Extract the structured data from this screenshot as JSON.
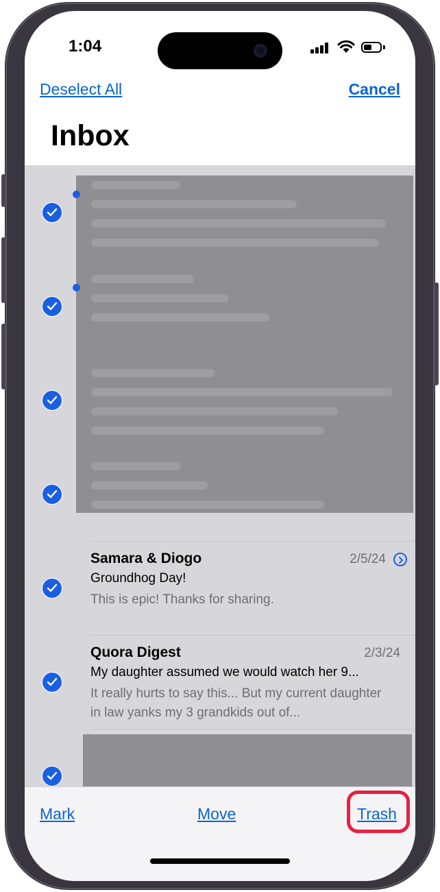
{
  "status_bar": {
    "time": "1:04"
  },
  "nav": {
    "left_action": "Deselect All",
    "right_action": "Cancel",
    "title": "Inbox"
  },
  "messages": [
    {
      "sender": "Samara & Diogo",
      "date": "2/5/24",
      "subject": "Groundhog Day!",
      "preview": "This is epic! Thanks for sharing.",
      "selected": true,
      "thread": true
    },
    {
      "sender": "Quora Digest",
      "date": "2/3/24",
      "subject": "My daughter assumed we would watch her 9...",
      "preview": "It really hurts to say this... But my current daughter in law yanks my 3 grandkids out of...",
      "selected": true,
      "thread": false
    }
  ],
  "toolbar": {
    "mark": "Mark",
    "move": "Move",
    "trash": "Trash"
  },
  "colors": {
    "accent": "#0a64d2",
    "check": "#1a5fe2",
    "highlight": "#e8203f"
  }
}
